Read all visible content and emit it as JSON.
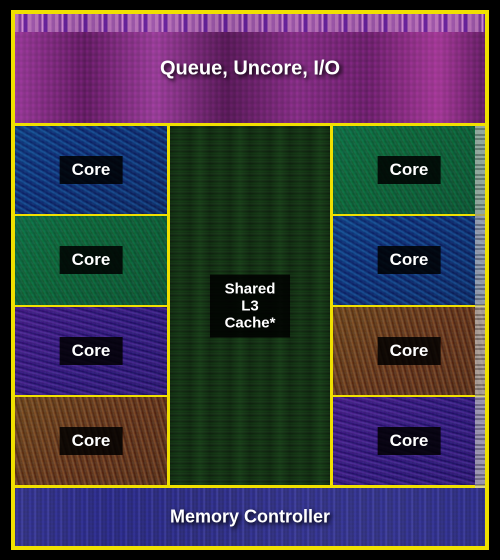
{
  "chip": {
    "border_color": "#f0e000",
    "top_label": "Queue, Uncore, I/O",
    "bottom_label": "Memory Controller",
    "cache_label": "Shared\nL3 Cache*",
    "cores": [
      {
        "id": "core-top-left",
        "label": "Core",
        "variant": "a"
      },
      {
        "id": "core-mid-left",
        "label": "Core",
        "variant": "b"
      },
      {
        "id": "core-btm-left",
        "label": "Core",
        "variant": "c"
      },
      {
        "id": "core-low-left",
        "label": "Core",
        "variant": "d"
      },
      {
        "id": "core-top-right",
        "label": "Core",
        "variant": "b"
      },
      {
        "id": "core-mid-right",
        "label": "Core",
        "variant": "a"
      },
      {
        "id": "core-btm-right",
        "label": "Core",
        "variant": "d"
      },
      {
        "id": "core-low-right",
        "label": "Core",
        "variant": "c"
      }
    ]
  }
}
